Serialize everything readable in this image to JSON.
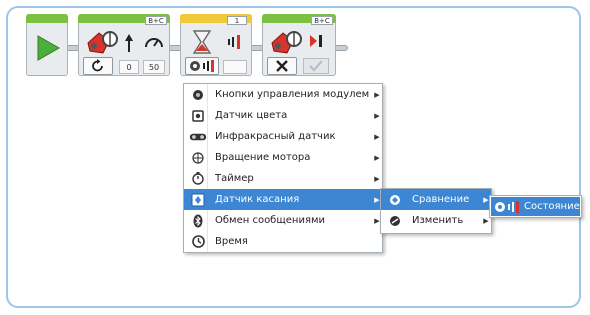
{
  "program": {
    "blocks": [
      {
        "kind": "start",
        "icon": "play-icon"
      },
      {
        "kind": "move-steering",
        "port": "B+C",
        "mode_icon": "rotate-icon",
        "values": [
          "0",
          "50"
        ]
      },
      {
        "kind": "wait",
        "port": "1",
        "mode_icon": "touch-sensor-icon"
      },
      {
        "kind": "move-steering",
        "port": "B+C",
        "mode_icon": "stop-icon",
        "brake_icon": "check-icon"
      }
    ]
  },
  "menu": {
    "items": [
      {
        "label": "Кнопки управления модулем",
        "icon": "brick-buttons-icon"
      },
      {
        "label": "Датчик цвета",
        "icon": "color-sensor-icon"
      },
      {
        "label": "Инфракрасный датчик",
        "icon": "infrared-sensor-icon"
      },
      {
        "label": "Вращение мотора",
        "icon": "motor-rotation-icon"
      },
      {
        "label": "Таймер",
        "icon": "timer-icon"
      },
      {
        "label": "Датчик касания",
        "icon": "touch-sensor-icon",
        "selected": true
      },
      {
        "label": "Обмен сообщениями",
        "icon": "bluetooth-icon"
      },
      {
        "label": "Время",
        "icon": "time-icon"
      }
    ]
  },
  "submenu": {
    "items": [
      {
        "label": "Сравнение",
        "icon": "compare-icon",
        "selected": true
      },
      {
        "label": "Изменить",
        "icon": "change-icon"
      }
    ]
  },
  "submenu2": {
    "items": [
      {
        "label": "Состояние",
        "icon": "state-icon",
        "selected": true
      }
    ]
  },
  "colors": {
    "accent": "#3c86d4",
    "canvas_border": "#9fc4ea",
    "action_tab": "#7cc242",
    "flow_tab": "#f2c93a",
    "motor_red": "#d9342b"
  }
}
